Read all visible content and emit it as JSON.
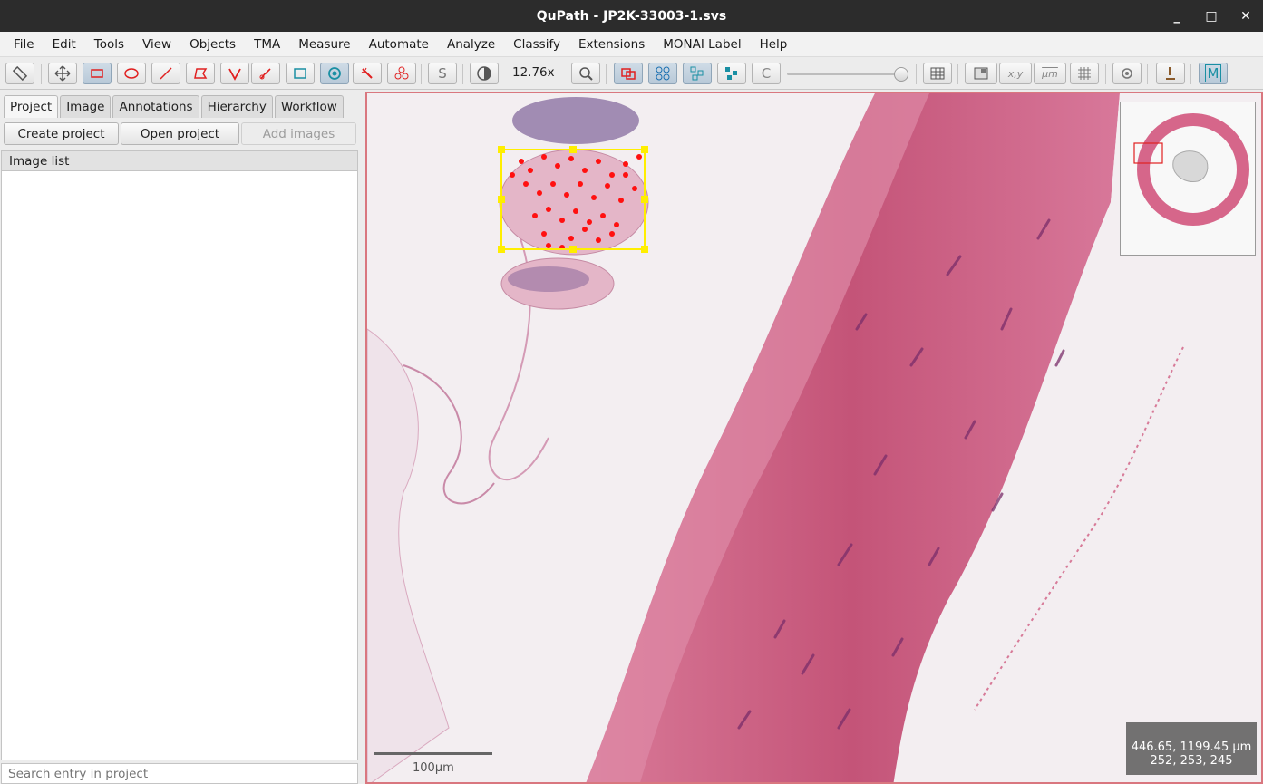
{
  "window": {
    "title": "QuPath - JP2K-33003-1.svs",
    "controls": [
      "_",
      "□",
      "✕"
    ]
  },
  "menu": [
    "File",
    "Edit",
    "Tools",
    "View",
    "Objects",
    "TMA",
    "Measure",
    "Automate",
    "Analyze",
    "Classify",
    "Extensions",
    "MONAI Label",
    "Help"
  ],
  "toolbar": {
    "zoom": "12.76x",
    "brush_label": "S",
    "contrast_label": "C",
    "coords_label": "x,y",
    "units_label": "µm",
    "monai_label": "M",
    "colors": {
      "accent_red": "#e02020",
      "accent_teal": "#1a8fa3",
      "selected": "#b8c9d8"
    }
  },
  "left_panel": {
    "tabs": [
      "Project",
      "Image",
      "Annotations",
      "Hierarchy",
      "Workflow"
    ],
    "active_tab": "Project",
    "buttons": {
      "create": "Create project",
      "open": "Open project",
      "add": "Add images"
    },
    "list_header": "Image list",
    "search_placeholder": "Search entry in project"
  },
  "viewer": {
    "scale_label": "100µm",
    "coords_line1": "446.65, 1199.45 µm",
    "coords_line2": "252, 253, 245",
    "annotation_color": "#ffee00",
    "detection_color": "#ff1010"
  }
}
